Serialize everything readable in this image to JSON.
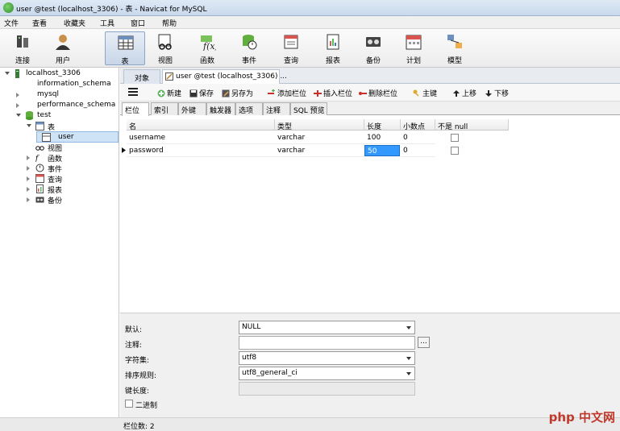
{
  "window": {
    "title": "user @test (localhost_3306) - 表 - Navicat for MySQL"
  },
  "menu": [
    "文件",
    "查看",
    "收藏夹",
    "工具",
    "窗口",
    "帮助"
  ],
  "toolbar": [
    {
      "label": "连接",
      "icon": "connection-icon"
    },
    {
      "label": "用户",
      "icon": "user-icon"
    },
    {
      "label": "表",
      "icon": "table-icon",
      "active": true
    },
    {
      "label": "视图",
      "icon": "view-icon"
    },
    {
      "label": "函数",
      "icon": "function-icon"
    },
    {
      "label": "事件",
      "icon": "event-icon"
    },
    {
      "label": "查询",
      "icon": "query-icon"
    },
    {
      "label": "报表",
      "icon": "report-icon"
    },
    {
      "label": "备份",
      "icon": "backup-icon"
    },
    {
      "label": "计划",
      "icon": "schedule-icon"
    },
    {
      "label": "模型",
      "icon": "model-icon"
    }
  ],
  "sidebar": {
    "connection": "localhost_3306",
    "databases": [
      "information_schema",
      "mysql",
      "performance_schema",
      "test"
    ],
    "test_children": [
      "表",
      "视图",
      "函数",
      "事件",
      "查询",
      "报表",
      "备份"
    ],
    "selected_table": "user"
  },
  "tabs": {
    "object": "对象",
    "editor": "user @test (localhost_3306) ..."
  },
  "editor_toolbar": [
    "新建",
    "保存",
    "另存为",
    "添加栏位",
    "插入栏位",
    "删除栏位",
    "主键",
    "上移",
    "下移"
  ],
  "subtabs": [
    "栏位",
    "索引",
    "外键",
    "触发器",
    "选项",
    "注释",
    "SQL 预览"
  ],
  "grid": {
    "headers": [
      "名",
      "类型",
      "长度",
      "小数点",
      "不是 null"
    ],
    "rows": [
      {
        "name": "username",
        "type": "varchar",
        "length": "100",
        "decimals": "0"
      },
      {
        "name": "password",
        "type": "varchar",
        "length": "50",
        "decimals": "0"
      }
    ]
  },
  "properties": {
    "default_label": "默认:",
    "default_value": "NULL",
    "comment_label": "注释:",
    "charset_label": "字符集:",
    "charset_value": "utf8",
    "collation_label": "排序规则:",
    "collation_value": "utf8_general_ci",
    "keylen_label": "键长度:",
    "binary_label": "二进制",
    "browse_button": "..."
  },
  "status": {
    "field_count": "栏位数: 2"
  },
  "watermark": "php 中文网",
  "colors": {
    "selection": "#3399ff",
    "accent": "#2e8b2e"
  }
}
